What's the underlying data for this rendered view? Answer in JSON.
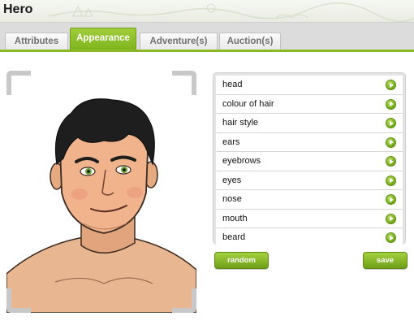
{
  "header": {
    "title": "Hero"
  },
  "tabs": [
    {
      "label": "Attributes",
      "active": false
    },
    {
      "label": "Appearance",
      "active": true
    },
    {
      "label": "Adventure(s)",
      "active": false
    },
    {
      "label": "Auction(s)",
      "active": false
    }
  ],
  "features": [
    {
      "label": "head",
      "icon": "arrow-right-icon"
    },
    {
      "label": "colour of hair",
      "icon": "arrow-right-icon"
    },
    {
      "label": "hair style",
      "icon": "arrow-right-icon"
    },
    {
      "label": "ears",
      "icon": "arrow-right-icon"
    },
    {
      "label": "eyebrows",
      "icon": "arrow-right-icon"
    },
    {
      "label": "eyes",
      "icon": "arrow-right-icon"
    },
    {
      "label": "nose",
      "icon": "arrow-right-icon"
    },
    {
      "label": "mouth",
      "icon": "arrow-right-icon"
    },
    {
      "label": "beard",
      "icon": "arrow-right-icon"
    }
  ],
  "buttons": {
    "random": "random",
    "save": "save"
  },
  "colors": {
    "accent": "#8ab827",
    "button": "#7fb41d",
    "tab_inactive_text": "#707070"
  }
}
